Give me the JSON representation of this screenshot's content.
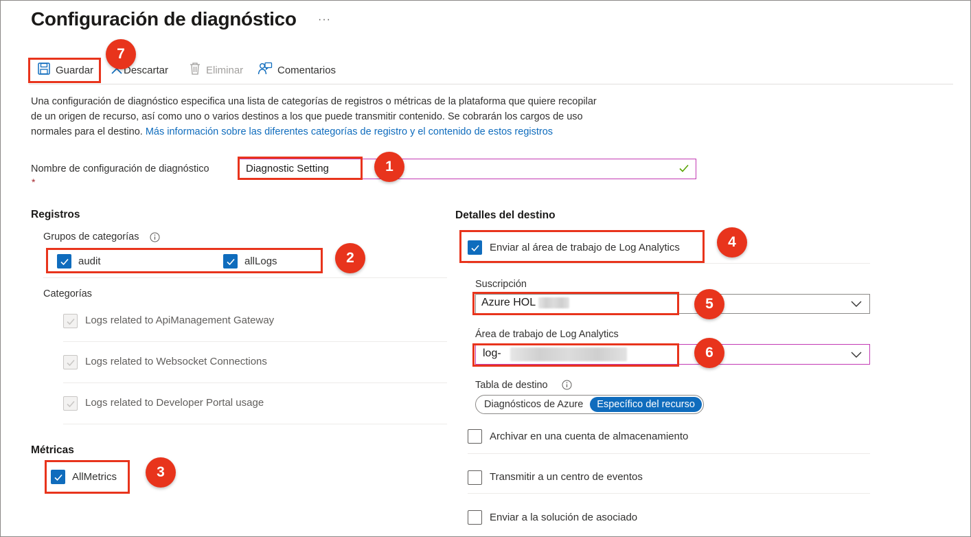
{
  "page": {
    "title": "Configuración de diagnóstico",
    "more_label": "···"
  },
  "toolbar": {
    "save_label": "Guardar",
    "discard_label": "Descartar",
    "delete_label": "Eliminar",
    "feedback_label": "Comentarios"
  },
  "description": {
    "text": "Una configuración de diagnóstico especifica una lista de categorías de registros o métricas de la plataforma que quiere recopilar de un origen de recurso, así como uno o varios destinos a los que puede transmitir contenido. Se cobrarán los cargos de uso normales para el destino. ",
    "link": "Más información sobre las diferentes categorías de registro y el contenido de estos registros"
  },
  "name_field": {
    "label": "Nombre de configuración de diagnóstico",
    "required_mark": "*",
    "value": "Diagnostic Setting"
  },
  "logs": {
    "heading": "Registros",
    "category_groups_label": "Grupos de categorías",
    "groups": [
      {
        "label": "audit",
        "checked": true
      },
      {
        "label": "allLogs",
        "checked": true
      }
    ],
    "categories_label": "Categorías",
    "categories": [
      {
        "label": "Logs related to ApiManagement Gateway",
        "checked": true,
        "disabled": true
      },
      {
        "label": "Logs related to Websocket Connections",
        "checked": true,
        "disabled": true
      },
      {
        "label": "Logs related to Developer Portal usage",
        "checked": true,
        "disabled": true
      }
    ]
  },
  "metrics": {
    "heading": "Métricas",
    "items": [
      {
        "label": "AllMetrics",
        "checked": true
      }
    ]
  },
  "destination": {
    "heading": "Detalles del destino",
    "log_analytics_label": "Enviar al área de trabajo de Log Analytics",
    "log_analytics_checked": true,
    "subscription_label": "Suscripción",
    "subscription_value": "Azure HOL",
    "workspace_label": "Área de trabajo de Log Analytics",
    "workspace_value": "log-",
    "table_label": "Tabla de destino",
    "table_options": [
      "Diagnósticos de Azure",
      "Específico del recurso"
    ],
    "table_selected": "Específico del recurso",
    "storage_label": "Archivar en una cuenta de almacenamiento",
    "eventhub_label": "Transmitir a un centro de eventos",
    "partner_label": "Enviar a la solución de asociado"
  },
  "callouts": [
    "1",
    "2",
    "3",
    "4",
    "5",
    "6",
    "7"
  ],
  "colors": {
    "accent": "#0f6cbd",
    "callout": "#e8341c",
    "valid_check": "#57a300"
  }
}
